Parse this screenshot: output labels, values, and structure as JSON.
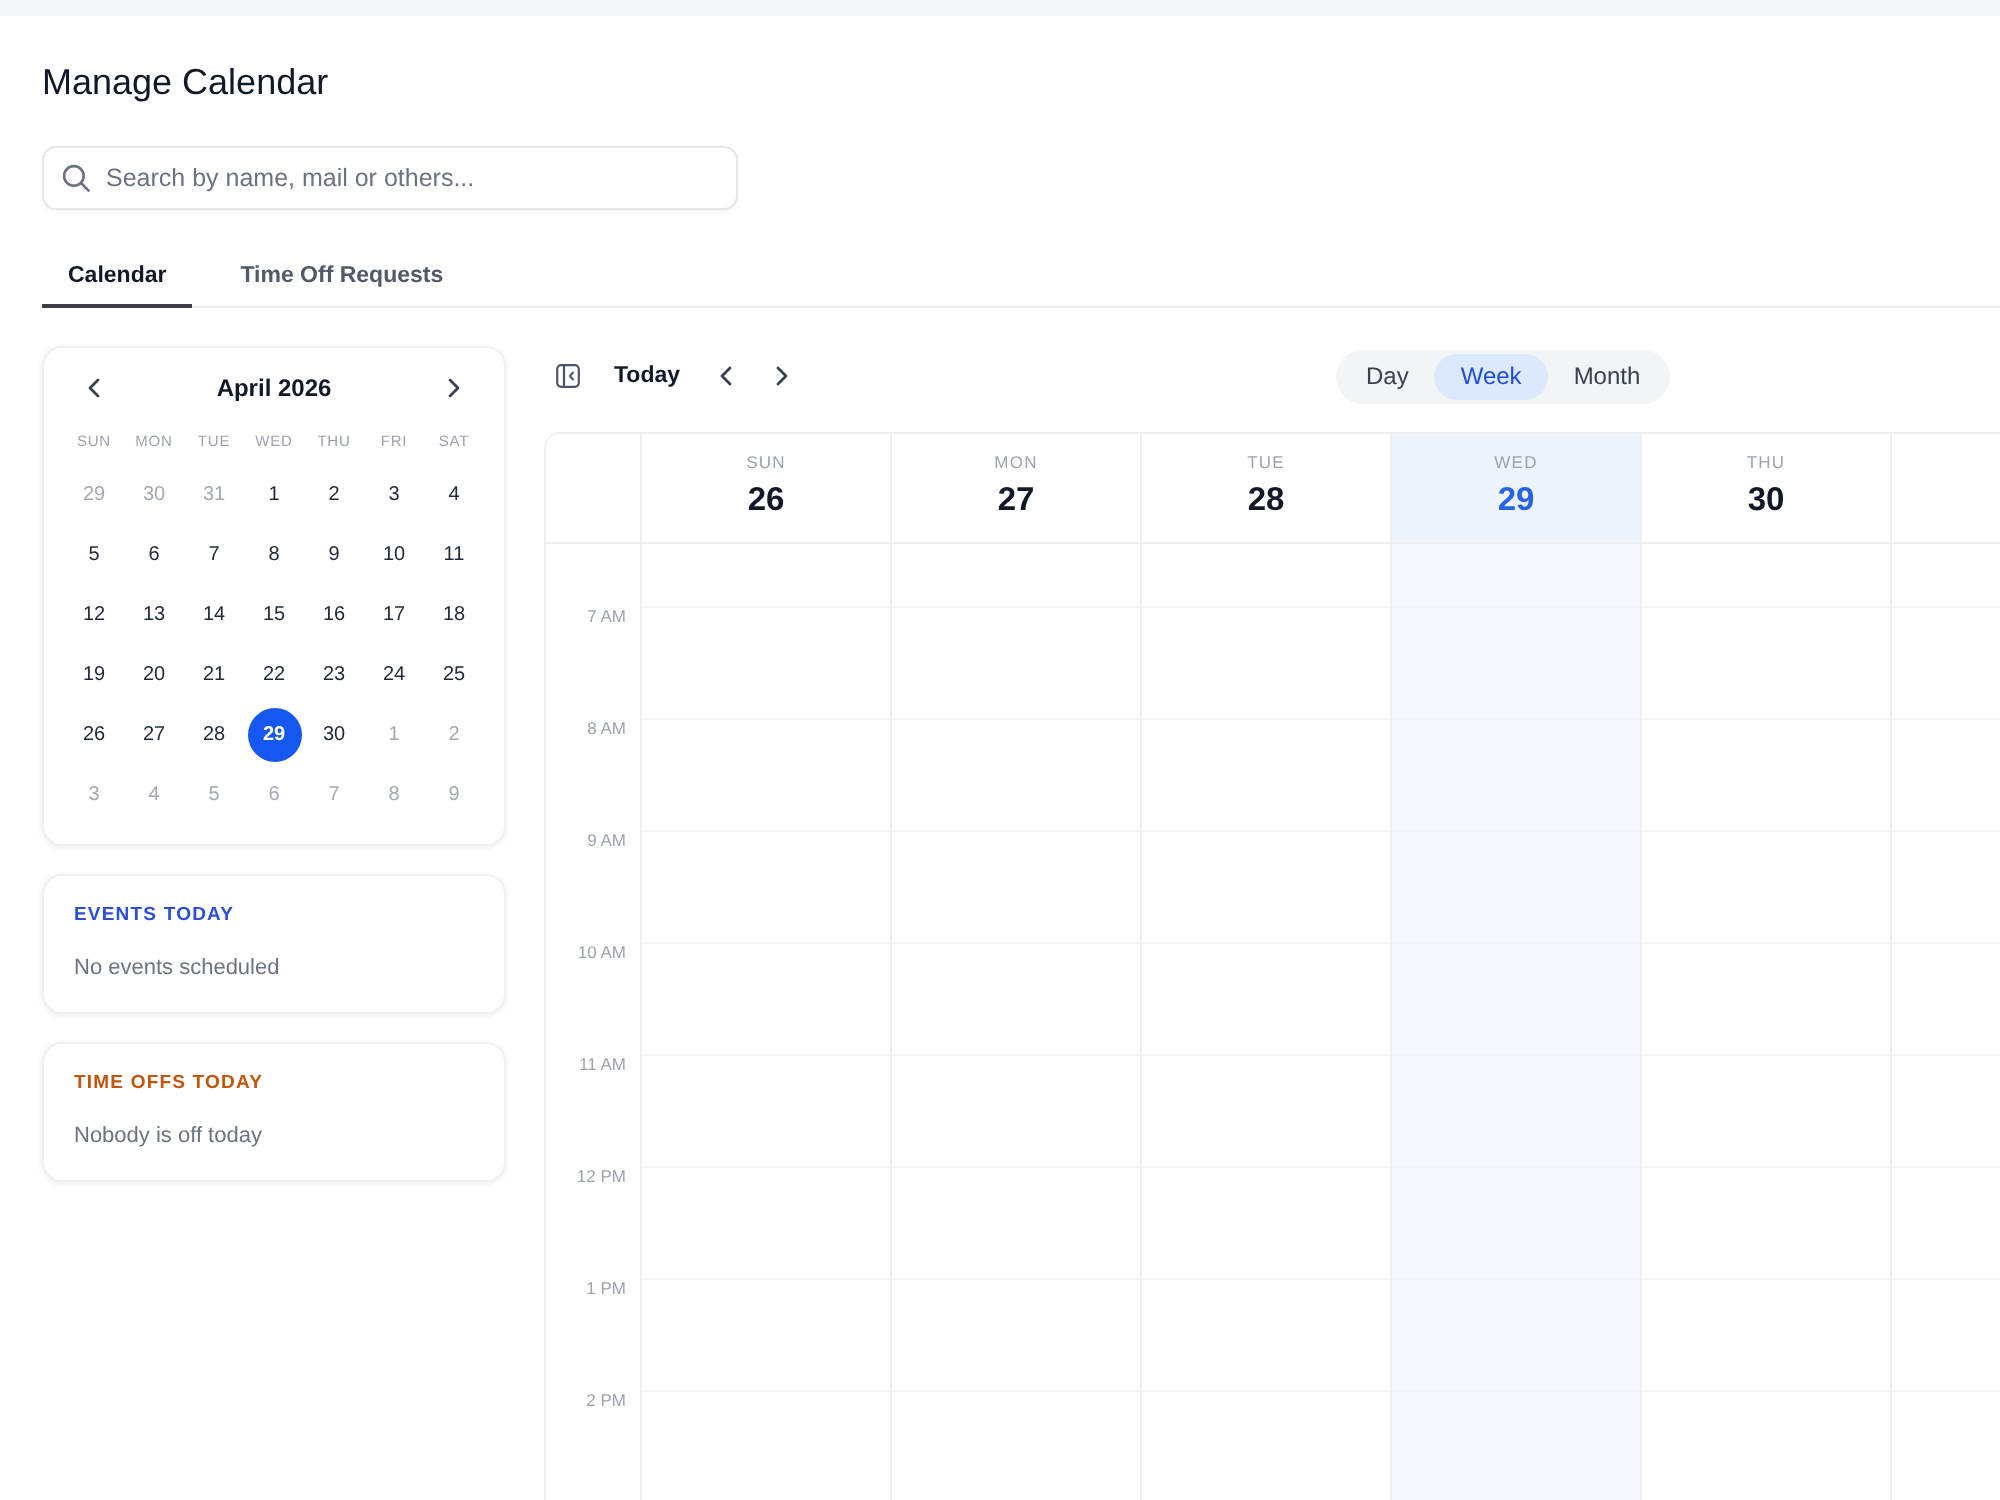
{
  "page": {
    "title": "Manage Calendar"
  },
  "search": {
    "placeholder": "Search by name, mail or others..."
  },
  "tabs": [
    {
      "label": "Calendar",
      "selected": true
    },
    {
      "label": "Time Off Requests",
      "selected": false
    }
  ],
  "mini_calendar": {
    "month": "April 2026",
    "weekdays": [
      "SUN",
      "MON",
      "TUE",
      "WED",
      "THU",
      "FRI",
      "SAT"
    ],
    "weeks": [
      [
        {
          "day": "29",
          "outside": true,
          "selected": false
        },
        {
          "day": "30",
          "outside": true,
          "selected": false
        },
        {
          "day": "31",
          "outside": true,
          "selected": false
        },
        {
          "day": "1",
          "outside": false,
          "selected": false
        },
        {
          "day": "2",
          "outside": false,
          "selected": false
        },
        {
          "day": "3",
          "outside": false,
          "selected": false
        },
        {
          "day": "4",
          "outside": false,
          "selected": false
        }
      ],
      [
        {
          "day": "5",
          "outside": false,
          "selected": false
        },
        {
          "day": "6",
          "outside": false,
          "selected": false
        },
        {
          "day": "7",
          "outside": false,
          "selected": false
        },
        {
          "day": "8",
          "outside": false,
          "selected": false
        },
        {
          "day": "9",
          "outside": false,
          "selected": false
        },
        {
          "day": "10",
          "outside": false,
          "selected": false
        },
        {
          "day": "11",
          "outside": false,
          "selected": false
        }
      ],
      [
        {
          "day": "12",
          "outside": false,
          "selected": false
        },
        {
          "day": "13",
          "outside": false,
          "selected": false
        },
        {
          "day": "14",
          "outside": false,
          "selected": false
        },
        {
          "day": "15",
          "outside": false,
          "selected": false
        },
        {
          "day": "16",
          "outside": false,
          "selected": false
        },
        {
          "day": "17",
          "outside": false,
          "selected": false
        },
        {
          "day": "18",
          "outside": false,
          "selected": false
        }
      ],
      [
        {
          "day": "19",
          "outside": false,
          "selected": false
        },
        {
          "day": "20",
          "outside": false,
          "selected": false
        },
        {
          "day": "21",
          "outside": false,
          "selected": false
        },
        {
          "day": "22",
          "outside": false,
          "selected": false
        },
        {
          "day": "23",
          "outside": false,
          "selected": false
        },
        {
          "day": "24",
          "outside": false,
          "selected": false
        },
        {
          "day": "25",
          "outside": false,
          "selected": false
        }
      ],
      [
        {
          "day": "26",
          "outside": false,
          "selected": false
        },
        {
          "day": "27",
          "outside": false,
          "selected": false
        },
        {
          "day": "28",
          "outside": false,
          "selected": false
        },
        {
          "day": "29",
          "outside": false,
          "selected": true
        },
        {
          "day": "30",
          "outside": false,
          "selected": false
        },
        {
          "day": "1",
          "outside": true,
          "selected": false
        },
        {
          "day": "2",
          "outside": true,
          "selected": false
        }
      ],
      [
        {
          "day": "3",
          "outside": true,
          "selected": false
        },
        {
          "day": "4",
          "outside": true,
          "selected": false
        },
        {
          "day": "5",
          "outside": true,
          "selected": false
        },
        {
          "day": "6",
          "outside": true,
          "selected": false
        },
        {
          "day": "7",
          "outside": true,
          "selected": false
        },
        {
          "day": "8",
          "outside": true,
          "selected": false
        },
        {
          "day": "9",
          "outside": true,
          "selected": false
        }
      ]
    ]
  },
  "summary_cards": [
    {
      "title": "EVENTS TODAY",
      "message": "No events scheduled",
      "color": "#2d4fd6"
    },
    {
      "title": "TIME OFFS TODAY",
      "message": "Nobody is off today",
      "color": "#c2560e"
    }
  ],
  "toolbar": {
    "today": "Today"
  },
  "views": [
    {
      "label": "Day",
      "selected": false
    },
    {
      "label": "Week",
      "selected": true
    },
    {
      "label": "Month",
      "selected": false
    }
  ],
  "week": {
    "days": [
      {
        "weekday": "SUN",
        "date": "26",
        "today": false
      },
      {
        "weekday": "MON",
        "date": "27",
        "today": false
      },
      {
        "weekday": "TUE",
        "date": "28",
        "today": false
      },
      {
        "weekday": "WED",
        "date": "29",
        "today": true
      },
      {
        "weekday": "THU",
        "date": "30",
        "today": false
      }
    ],
    "hours": [
      "7 AM",
      "8 AM",
      "9 AM",
      "10 AM",
      "11 AM",
      "12 PM",
      "1 PM",
      "2 PM"
    ]
  }
}
